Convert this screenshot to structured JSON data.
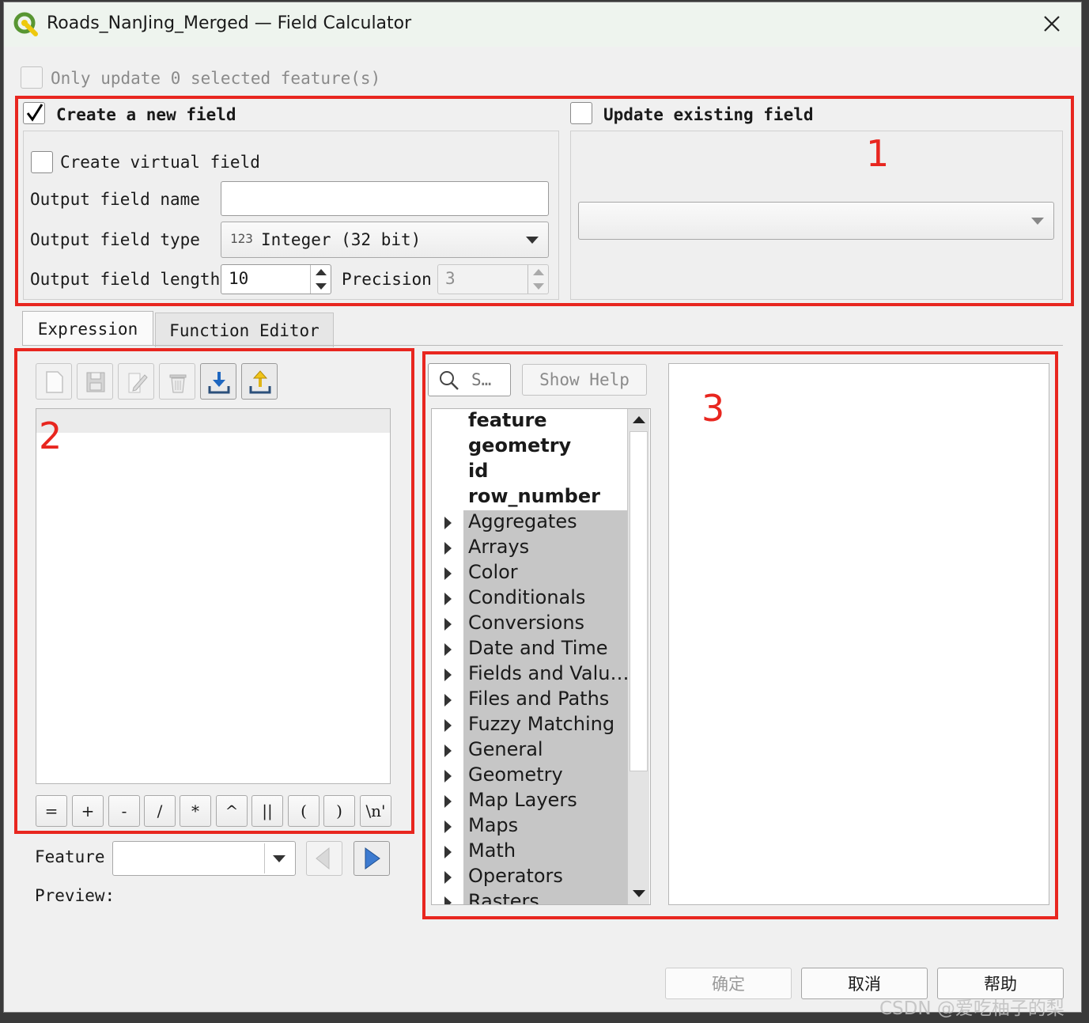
{
  "window": {
    "title": "Roads_NanJing_Merged — Field Calculator",
    "close_icon": "close-icon"
  },
  "only_update": {
    "label": "Only update 0 selected feature(s)",
    "checked": false
  },
  "create_field": {
    "label": "Create a new field",
    "checked": true,
    "virtual_label": "Create virtual field",
    "name_label": "Output field name",
    "name_value": "",
    "type_label": "Output field type",
    "type_prefix": "123",
    "type_value": "Integer (32 bit)",
    "length_label": "Output field length",
    "length_value": "10",
    "precision_label": "Precision",
    "precision_value": "3"
  },
  "update_field": {
    "label": "Update existing field",
    "checked": false,
    "field_value": ""
  },
  "annotations": {
    "n1": "1",
    "n2": "2",
    "n3": "3"
  },
  "tabs": [
    {
      "label": "Expression",
      "active": true
    },
    {
      "label": "Function Editor",
      "active": false
    }
  ],
  "toolbar_icons": [
    "new-file-icon",
    "save-icon",
    "edit-icon",
    "delete-icon",
    "import-icon",
    "export-icon"
  ],
  "operators": [
    "=",
    "+",
    "-",
    "/",
    "*",
    "^",
    "||",
    "(",
    ")",
    "\\n'"
  ],
  "feature": {
    "label": "Feature",
    "value": "",
    "preview_label": "Preview:"
  },
  "search": {
    "placeholder": "S…",
    "show_help": "Show Help"
  },
  "tree": {
    "top_items": [
      "feature",
      "geometry",
      "id",
      "row_number"
    ],
    "groups": [
      "Aggregates",
      "Arrays",
      "Color",
      "Conditionals",
      "Conversions",
      "Date and Time",
      "Fields and Valu…",
      "Files and Paths",
      "Fuzzy Matching",
      "General",
      "Geometry",
      "Map Layers",
      "Maps",
      "Math",
      "Operators",
      "Rasters"
    ]
  },
  "buttons": {
    "ok": "确定",
    "cancel": "取消",
    "help": "帮助"
  },
  "watermark": "CSDN @爱吃柚子的梨",
  "colors": {
    "annotation_red": "#e8261f",
    "qgis_green": "#589632",
    "qgis_yellow": "#eec90d"
  }
}
